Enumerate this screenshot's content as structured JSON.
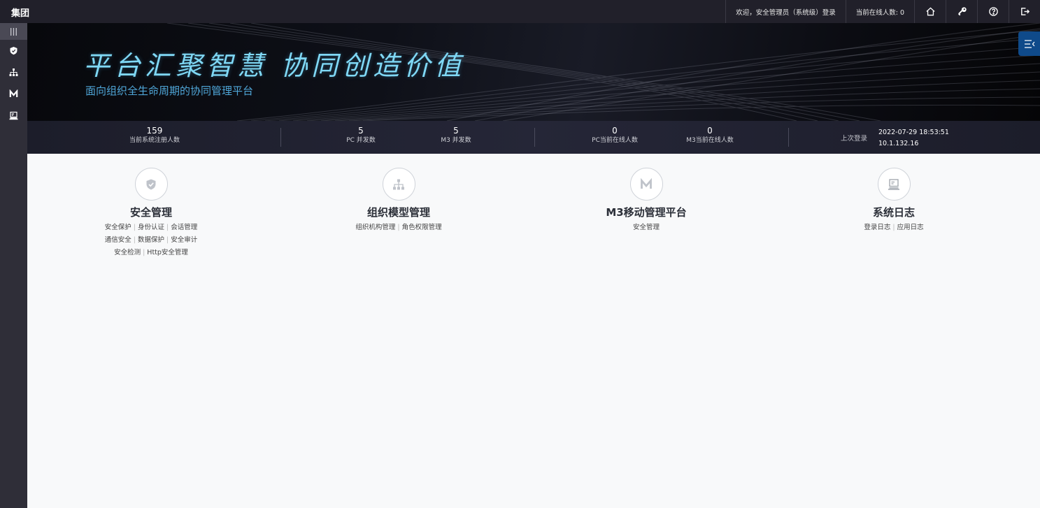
{
  "app": {
    "brand": "集团"
  },
  "topbar": {
    "welcome": "欢迎，安全管理员（系统级）登录",
    "online": "当前在线人数: 0",
    "icons": [
      "home-icon",
      "key-icon",
      "help-icon",
      "logout-icon"
    ]
  },
  "sidebar": {
    "items": [
      "menu-icon",
      "shield-icon",
      "org-tree-icon",
      "m3-icon",
      "computer-icon"
    ]
  },
  "banner": {
    "slogan": "平台汇聚智慧 协同创造价值",
    "subtitle": "面向组织全生命周期的协同管理平台"
  },
  "stats": {
    "registered": {
      "value": "159",
      "label": "当前系统注册人数"
    },
    "pc_concurrent": {
      "value": "5",
      "label": "PC 并发数"
    },
    "m3_concurrent": {
      "value": "5",
      "label": "M3 并发数"
    },
    "pc_online": {
      "value": "0",
      "label": "PC当前在线人数"
    },
    "m3_online": {
      "value": "0",
      "label": "M3当前在线人数"
    },
    "last_login": {
      "label": "上次登录",
      "time": "2022-07-29 18:53:51",
      "ip": "10.1.132.16"
    }
  },
  "modules": [
    {
      "title": "安全管理",
      "links": [
        [
          "安全保护",
          "身份认证",
          "会话管理"
        ],
        [
          "通信安全",
          "数据保护",
          "安全审计"
        ],
        [
          "安全检测",
          "Http安全管理"
        ]
      ]
    },
    {
      "title": "组织模型管理",
      "links": [
        [
          "组织机构管理",
          "角色权限管理"
        ]
      ]
    },
    {
      "title": "M3移动管理平台",
      "links": [
        [
          "安全管理"
        ]
      ]
    },
    {
      "title": "系统日志",
      "links": [
        [
          "登录日志",
          "应用日志"
        ]
      ]
    }
  ],
  "colors": {
    "topbar": "#21202a",
    "sidebar": "#2f2e38",
    "accent": "#0f4a8a",
    "slogan": "#7fd8f5",
    "subtitle": "#4fa6d8"
  }
}
